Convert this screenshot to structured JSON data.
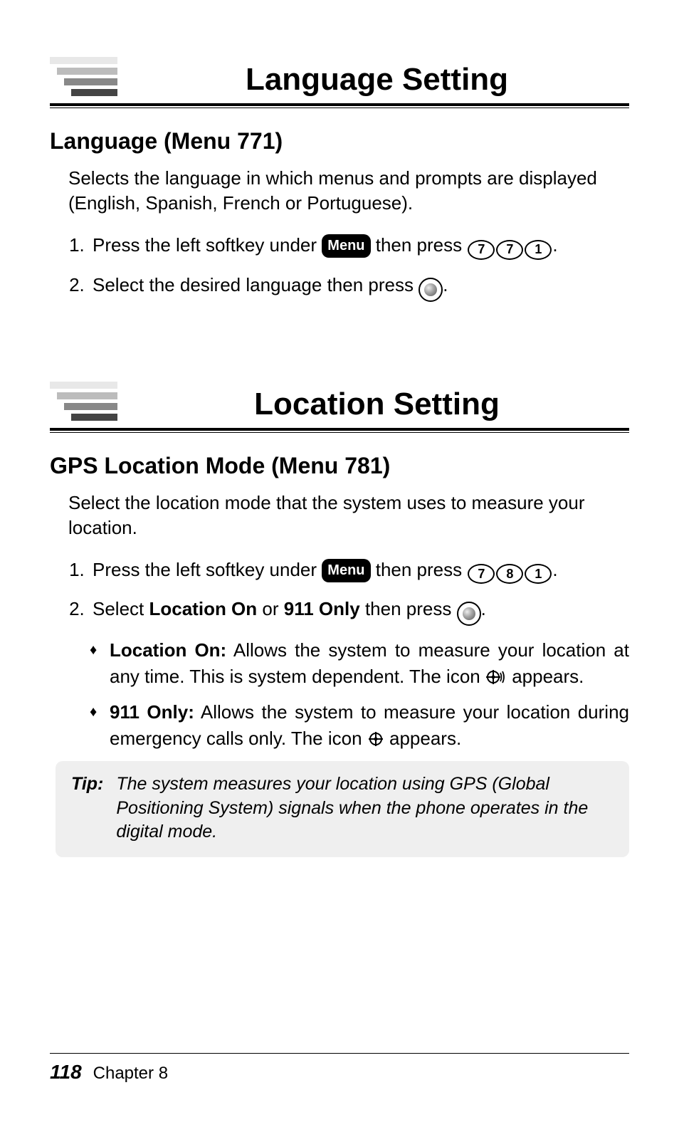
{
  "section1": {
    "title": "Language Setting",
    "subheading": "Language (Menu 771)",
    "para": "Selects the language in which menus and prompts are displayed (English, Spanish, French or Portuguese).",
    "step1_pre": "Press the left softkey under ",
    "step1_mid": " then press ",
    "step2_pre": "Select the desired language then press ",
    "menu_label": "Menu",
    "keys": [
      "7",
      "7",
      "1"
    ]
  },
  "section2": {
    "title": "Location Setting",
    "subheading": "GPS Location Mode (Menu 781)",
    "para": "Select the location mode that the system uses to measure your location.",
    "step1_pre": "Press the left softkey under ",
    "step1_mid": " then press ",
    "menu_label": "Menu",
    "keys": [
      "7",
      "8",
      "1"
    ],
    "step2_a": "Select ",
    "step2_b": "Location On",
    "step2_c": " or ",
    "step2_d": "911 Only",
    "step2_e": " then press ",
    "bullet1_label": "Location On:",
    "bullet1_text_a": " Allows the system to measure your location at any time. This is system dependent. The icon ",
    "bullet1_text_b": " appears.",
    "bullet2_label": "911 Only:",
    "bullet2_text_a": " Allows the system to measure your location during emergency calls only. The icon ",
    "bullet2_text_b": " appears.",
    "tip_label": "Tip:",
    "tip_text": "The system measures your location using GPS (Global Positioning System) signals when the phone operates in the digital mode."
  },
  "footer": {
    "page": "118",
    "chapter": "Chapter 8"
  },
  "period": "."
}
